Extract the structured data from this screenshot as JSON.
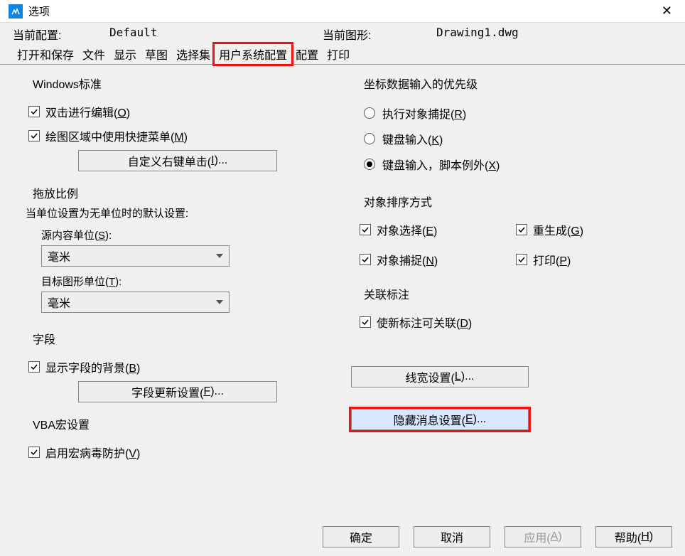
{
  "title": "选项",
  "info": {
    "current_config_label": "当前配置:",
    "current_config_value": "Default",
    "current_drawing_label": "当前图形:",
    "current_drawing_value": "Drawing1.dwg"
  },
  "tabs": [
    "打开和保存",
    "文件",
    "显示",
    "草图",
    "选择集",
    "用户系统配置",
    "配置",
    "打印"
  ],
  "active_tab_index": 5,
  "left": {
    "windows_std": {
      "title": "Windows标准",
      "dbl_click_edit": "双击进行编辑(O)",
      "shortcut_menu": "绘图区域中使用快捷菜单(M)",
      "right_click_btn": "自定义右键单击(I)..."
    },
    "drag_scale": {
      "title": "拖放比例",
      "desc": "当单位设置为无单位时的默认设置:",
      "src_label": "源内容单位(S):",
      "src_value": "毫米",
      "tgt_label": "目标图形单位(T):",
      "tgt_value": "毫米"
    },
    "field": {
      "title": "字段",
      "show_bg": "显示字段的背景(B)",
      "update_btn": "字段更新设置(F)..."
    },
    "vba": {
      "title": "VBA宏设置",
      "enable": "启用宏病毒防护(V)"
    }
  },
  "right": {
    "coord": {
      "title": "坐标数据输入的优先级",
      "opt1": "执行对象捕捉(R)",
      "opt2": "键盘输入(K)",
      "opt3": "键盘输入，脚本例外(X)"
    },
    "sort": {
      "title": "对象排序方式",
      "select": "对象选择(E)",
      "regen": "重生成(G)",
      "snap": "对象捕捉(N)",
      "print": "打印(P)"
    },
    "assoc": {
      "title": "关联标注",
      "chk": "使新标注可关联(D)"
    },
    "lineweight_btn": "线宽设置(L)...",
    "hidden_msg_btn": "隐藏消息设置(E)..."
  },
  "footer": {
    "ok": "确定",
    "cancel": "取消",
    "apply": "应用(A)",
    "help": "帮助(H)"
  }
}
